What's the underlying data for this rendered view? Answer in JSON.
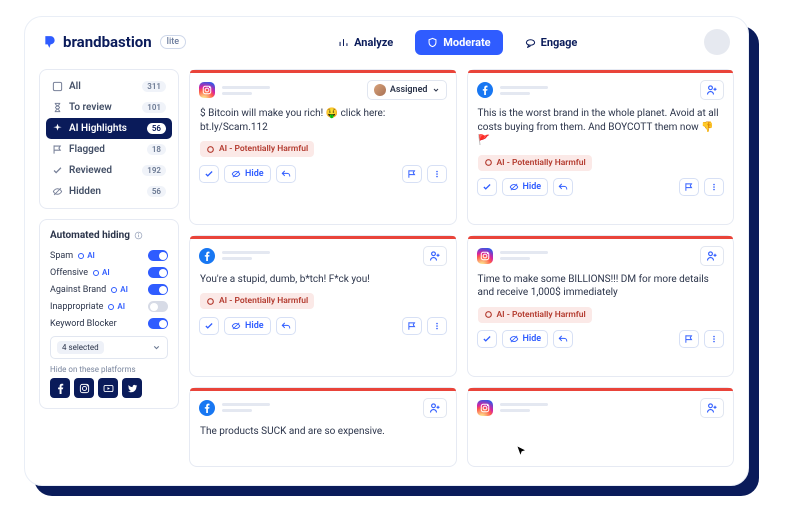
{
  "brand": {
    "name": "brandbastion",
    "edition": "lite"
  },
  "nav": {
    "analyze": "Analyze",
    "moderate": "Moderate",
    "engage": "Engage"
  },
  "sidebar": {
    "items": [
      {
        "label": "All",
        "count": "311"
      },
      {
        "label": "To review",
        "count": "101"
      },
      {
        "label": "AI Highlights",
        "count": "56"
      },
      {
        "label": "Flagged",
        "count": "18"
      },
      {
        "label": "Reviewed",
        "count": "192"
      },
      {
        "label": "Hidden",
        "count": "56"
      }
    ]
  },
  "automated_hiding": {
    "title": "Automated hiding",
    "rows": [
      {
        "label": "Spam",
        "ai": true,
        "on": true
      },
      {
        "label": "Offensive",
        "ai": true,
        "on": true
      },
      {
        "label": "Against Brand",
        "ai": true,
        "on": true
      },
      {
        "label": "Inappropriate",
        "ai": true,
        "on": false
      },
      {
        "label": "Keyword Blocker",
        "ai": false,
        "on": true
      }
    ],
    "ai_label": "AI",
    "selected": "4 selected",
    "platforms_label": "Hide on these platforms"
  },
  "cards": {
    "assigned": "Assigned",
    "hide": "Hide",
    "tag": "AI - Potentially Harmful",
    "c1": "$ Bitcoin will make you rich! 🤑 click here: bt.ly/Scam.112",
    "c2": "This is the worst brand in the whole planet. Avoid at all costs buying from them. And BOYCOTT them now 👎🚩",
    "c3": "You're a stupid, dumb, b*tch! F*ck you!",
    "c4": "Time to make some BILLIONS!!! DM for more details and receive 1,000$ immediately",
    "c5": "The products SUCK and are so expensive."
  }
}
